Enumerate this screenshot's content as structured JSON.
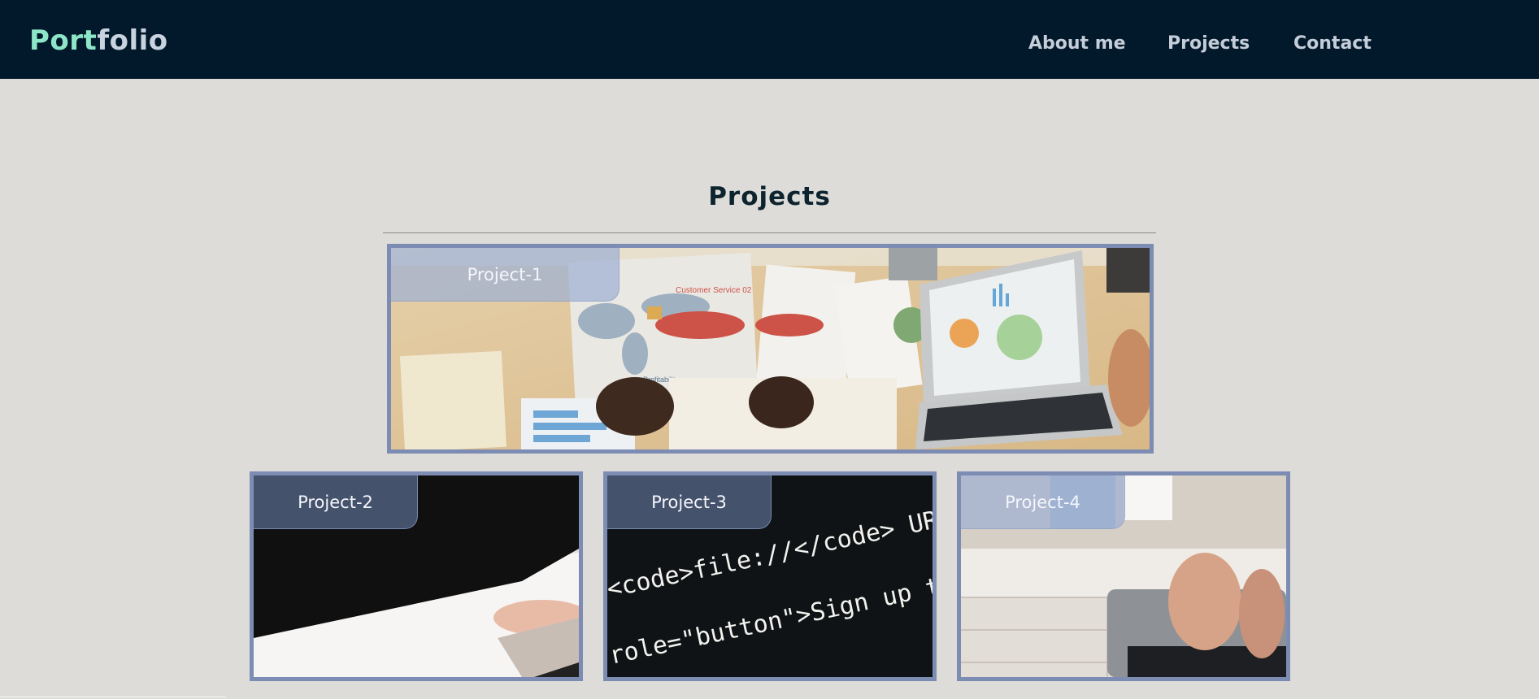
{
  "navbar": {
    "logo_part1": "Port",
    "logo_part2": "folio",
    "links": [
      "About me",
      "Projects",
      "Contact"
    ]
  },
  "main": {
    "title": "Projects",
    "projects": [
      {
        "label": "Project-1"
      },
      {
        "label": "Project-2"
      },
      {
        "label": "Project-3"
      },
      {
        "label": "Project-4"
      }
    ],
    "code_lines": [
      "<code>file://</code> URL, the",
      "role=\"button\">Sign up toda"
    ],
    "map_labels": [
      "Customer Service 02",
      "Profitability"
    ]
  },
  "colors": {
    "navbar_bg": "#01192b",
    "page_bg": "#dddcd8",
    "logo_accent": "#8ee6c9",
    "card_border": "#7c8cb3"
  }
}
